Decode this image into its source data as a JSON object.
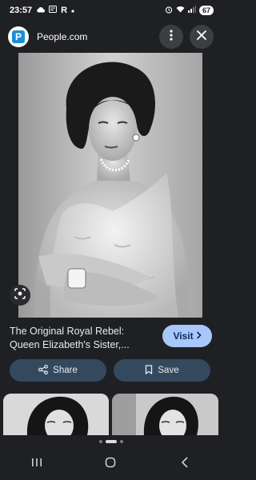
{
  "status_bar": {
    "time": "23:57",
    "notif_r": "R",
    "battery": "67",
    "icons": [
      "cloud-icon",
      "message-icon",
      "dot-icon",
      "alarm-icon",
      "wifi-icon",
      "signal-icon",
      "battery-icon"
    ]
  },
  "header": {
    "site_name": "People.com",
    "logo_letter": "P",
    "icons": [
      "more-vert-icon",
      "close-icon"
    ]
  },
  "preview": {
    "title": "The Original Royal Rebel: Queen Elizabeth's Sister,...",
    "visit_label": "Visit",
    "share_label": "Share",
    "save_label": "Save"
  },
  "pager": {
    "count": 3,
    "active": 1
  },
  "nav": {
    "icons": [
      "recents-icon",
      "home-icon",
      "back-icon"
    ]
  },
  "colors": {
    "background": "#1f2023",
    "visit_button": "#a8c7fa",
    "action_button": "#34495e"
  }
}
